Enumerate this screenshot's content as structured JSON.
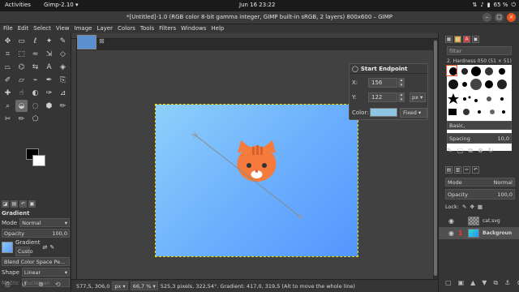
{
  "topbar": {
    "activities": "Activities",
    "app_menu": "Gimp-2.10 ▾",
    "clock": "Jun 16  23:22",
    "battery": "65 %"
  },
  "window": {
    "title": "*[Untitled]-1.0 (RGB color 8-bit gamma integer, GIMP built-in sRGB, 2 layers) 800x600 – GIMP",
    "controls": [
      "–",
      "□",
      "×"
    ]
  },
  "menu": [
    "File",
    "Edit",
    "Select",
    "View",
    "Image",
    "Layer",
    "Colors",
    "Tools",
    "Filters",
    "Windows",
    "Help"
  ],
  "tool_options": {
    "title": "Gradient",
    "mode_label": "Mode",
    "mode_value": "Normal",
    "opacity_label": "Opacity",
    "opacity_value": "100,0",
    "gradient_label": "Gradient",
    "gradient_value": "Custo",
    "blend_space": "Blend Color Space Pe...",
    "shape_label": "Shape",
    "shape_value": "Linear",
    "metric_label": "Metric",
    "metric_value": "Euclidean"
  },
  "endpoint_dialog": {
    "title": "Start Endpoint",
    "x_label": "X:",
    "x_value": "156",
    "y_label": "Y:",
    "y_value": "122",
    "unit": "px",
    "color_label": "Color:",
    "color_swatch": "#8ec5e2",
    "color_mode": "Fixed"
  },
  "statusbar": {
    "coords": "577,5, 306,0",
    "unit": "px",
    "zoom": "66,7 %",
    "message": "525,3 pixels, 322,54°. Gradient: 417,0, 319,5 (Alt to move the whole line)"
  },
  "dock": {
    "filter_placeholder": "filter",
    "brush_name": "2. Hardness 050 (51 × 51)",
    "brush_tag": "Basic,",
    "spacing_label": "Spacing",
    "spacing_value": "10,0",
    "layers": {
      "mode_label": "Mode",
      "mode_value": "Normal",
      "opacity_label": "Opacity",
      "opacity_value": "100,0",
      "lock_label": "Lock:",
      "items": [
        {
          "name": "cat.svg"
        },
        {
          "name": "Backgroun"
        }
      ]
    }
  },
  "colors": {
    "accent": "#e95420",
    "selection": "#e8e000",
    "gradient_start": "#8ed0fa",
    "gradient_end": "#5595ff",
    "cat_orange": "#f47b3b"
  }
}
